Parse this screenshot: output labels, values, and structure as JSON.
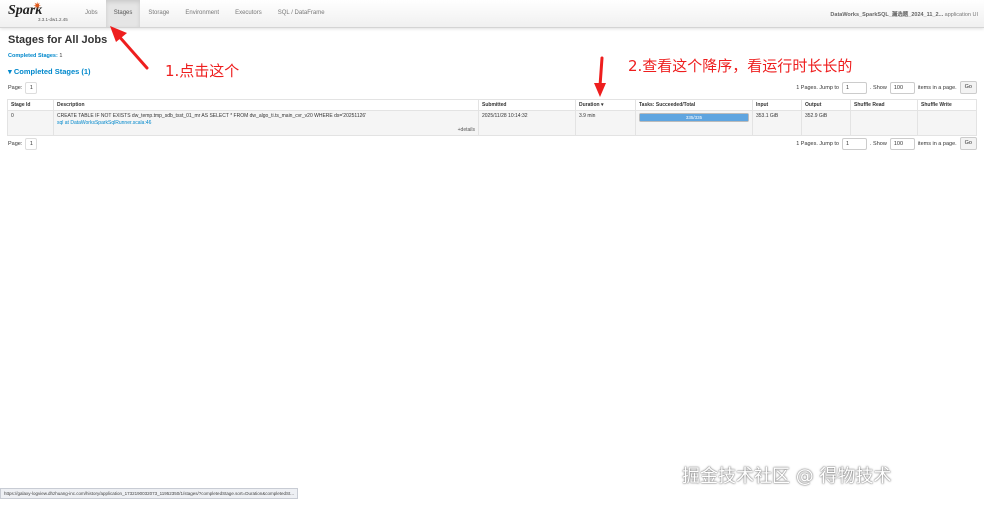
{
  "navbar": {
    "logo_text": "Spark",
    "version": "3.3.1-dw1.2.45",
    "tabs": [
      {
        "label": "Jobs",
        "active": false
      },
      {
        "label": "Stages",
        "active": true
      },
      {
        "label": "Storage",
        "active": false
      },
      {
        "label": "Environment",
        "active": false
      },
      {
        "label": "Executors",
        "active": false
      },
      {
        "label": "SQL / DataFrame",
        "active": false
      }
    ],
    "app_name": "DataWorks_SparkSQL_漏选题_2024_11_2...",
    "app_suffix": "application UI"
  },
  "page": {
    "title": "Stages for All Jobs",
    "summary_label": "Completed Stages:",
    "summary_value": "1",
    "section_toggle": "Completed Stages (1)"
  },
  "pagination": {
    "page_label": "Page:",
    "page_number": "1",
    "pages_text": "1 Pages. Jump to",
    "jump_value": "1",
    "show_label": ". Show",
    "show_value": "100",
    "items_text": "items in a page.",
    "go_label": "Go"
  },
  "table": {
    "headers": [
      "Stage Id",
      "Description",
      "Submitted",
      "Duration ▾",
      "Tasks: Succeeded/Total",
      "Input",
      "Output",
      "Shuffle Read",
      "Shuffle Write"
    ],
    "rows": [
      {
        "stage_id": "0",
        "description_sql": "CREATE TABLE IF NOT EXISTS dw_temp.tmp_sdb_tsst_01_mr AS SELECT * FROM dw_algo_ti.ts_main_cvr_v20 WHERE ds='20251126'",
        "description_link": "sql at DataWorksSparkSqlRunner.scala:46",
        "details_label": "+details",
        "submitted": "2025/11/28 10:14:32",
        "duration": "3.9 min",
        "tasks_text": "335/335",
        "tasks_fraction": 1.0,
        "input": "353.1 GiB",
        "output": "352.9 GiB",
        "shuffle_read": "",
        "shuffle_write": ""
      }
    ]
  },
  "annotations": {
    "step1": "1.点击这个",
    "step2": "2.查看这个降序，看运行时长长的",
    "color": "#ee1e1e"
  },
  "watermark": "掘金技术社区 @ 得物技术",
  "status_url": "https://galaxy-logview.dhzhuang-inc.com/history/application_1732190032073_11952350/1/stages/?completedStage.sort=Duration&completedSt..."
}
